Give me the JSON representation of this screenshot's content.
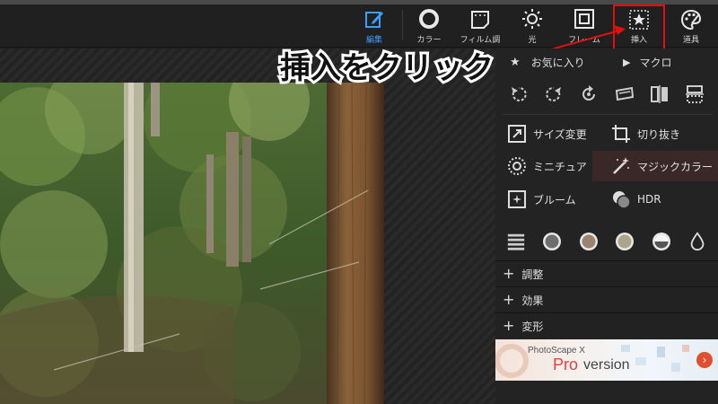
{
  "toolbar": {
    "tools": [
      {
        "id": "edit",
        "label": "編集",
        "icon": "edit-icon"
      },
      {
        "id": "color",
        "label": "カラー",
        "icon": "color-circle-icon"
      },
      {
        "id": "film",
        "label": "フィルム調",
        "icon": "film-icon"
      },
      {
        "id": "light",
        "label": "光",
        "icon": "sun-icon"
      },
      {
        "id": "frame",
        "label": "フレーム",
        "icon": "frame-icon"
      },
      {
        "id": "insert",
        "label": "挿入",
        "icon": "insert-star-icon"
      },
      {
        "id": "tools",
        "label": "道具",
        "icon": "palette-icon"
      }
    ],
    "active_color": "#3aa0ff",
    "highlight_color": "#e01010"
  },
  "annotation": {
    "text": "挿入をクリック"
  },
  "panel": {
    "favorites_label": "お気に入り",
    "macro_label": "マクロ",
    "features": [
      {
        "label": "サイズ変更",
        "icon": "resize-icon"
      },
      {
        "label": "切り抜き",
        "icon": "crop-icon"
      },
      {
        "label": "ミニチュア",
        "icon": "miniature-icon"
      },
      {
        "label": "マジックカラー",
        "icon": "magic-wand-icon"
      },
      {
        "label": "ブルーム",
        "icon": "bloom-icon"
      },
      {
        "label": "HDR",
        "icon": "hdr-icon"
      }
    ],
    "sections": [
      {
        "label": "調整"
      },
      {
        "label": "効果"
      },
      {
        "label": "変形"
      }
    ],
    "banner": {
      "small": "PhotoScape X",
      "pro": "Pro",
      "version": "version"
    }
  }
}
